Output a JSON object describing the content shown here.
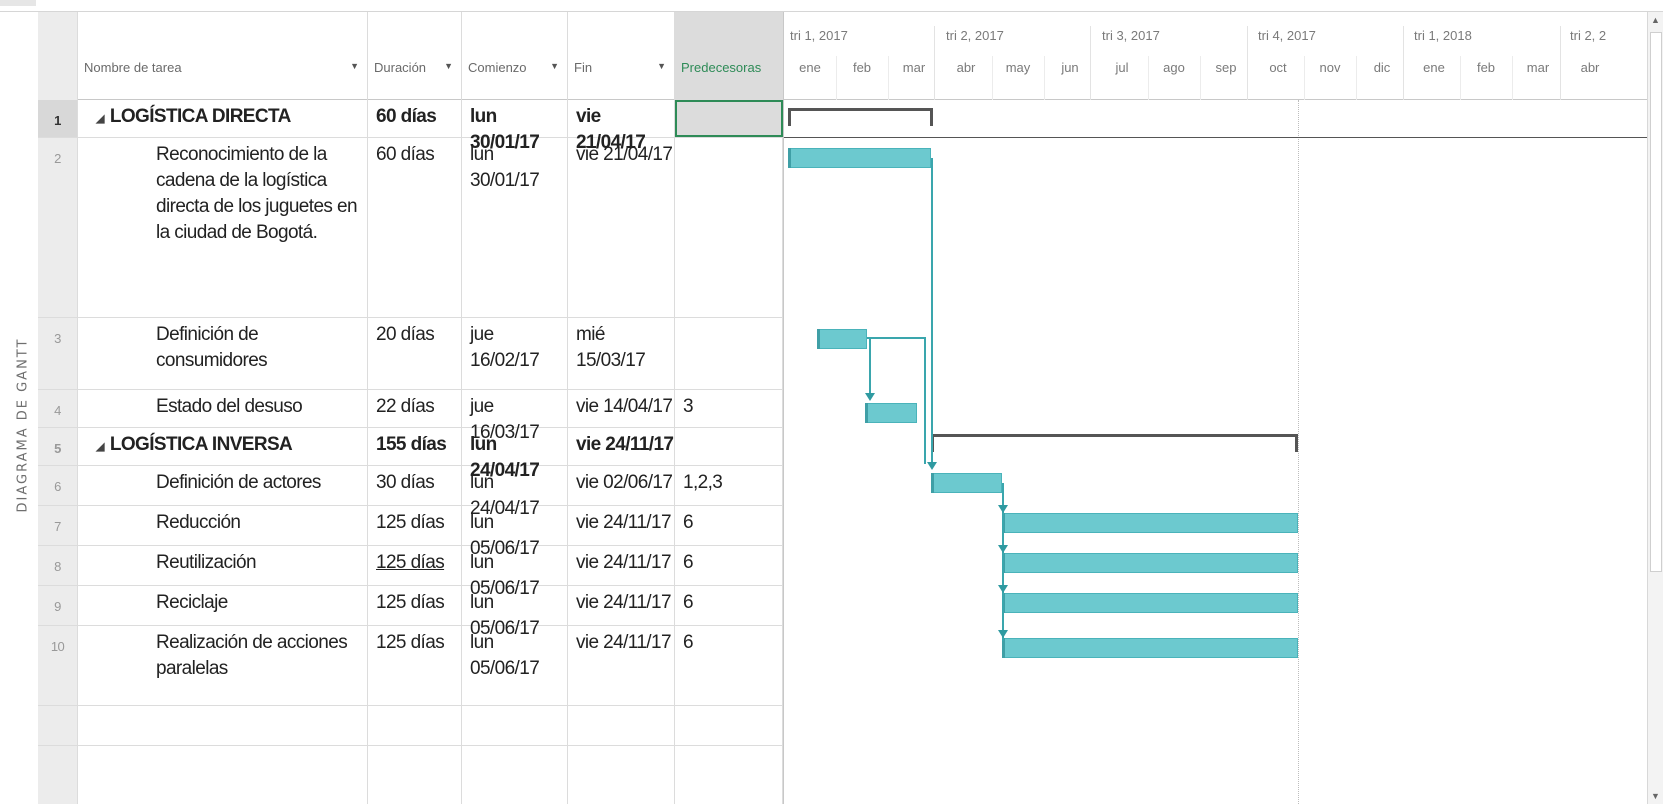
{
  "side_label": "DIAGRAMA DE GANTT",
  "columns": {
    "name": "Nombre de tarea",
    "duration": "Duración",
    "start": "Comienzo",
    "finish": "Fin",
    "predecessors": "Predecesoras"
  },
  "timescale": {
    "quarters": [
      "tri 1, 2017",
      "tri 2, 2017",
      "tri 3, 2017",
      "tri 4, 2017",
      "tri 1, 2018",
      "tri 2, 2"
    ],
    "months": [
      "ene",
      "feb",
      "mar",
      "abr",
      "may",
      "jun",
      "jul",
      "ago",
      "sep",
      "oct",
      "nov",
      "dic",
      "ene",
      "feb",
      "mar",
      "abr"
    ]
  },
  "tasks": [
    {
      "id": "1",
      "name": "LOGÍSTICA DIRECTA",
      "duration": "60 días",
      "start": "lun 30/01/17",
      "finish": "vie 21/04/17",
      "pred": "",
      "summary": true
    },
    {
      "id": "2",
      "name": "Reconocimiento de la cadena de la logística directa de los juguetes en la ciudad de Bogotá.",
      "duration": "60 días",
      "start": "lun 30/01/17",
      "finish": "vie 21/04/17",
      "pred": "",
      "summary": false
    },
    {
      "id": "3",
      "name": "Definición de consumidores",
      "duration": "20 días",
      "start": "jue 16/02/17",
      "finish": "mié 15/03/17",
      "pred": "",
      "summary": false
    },
    {
      "id": "4",
      "name": "Estado del desuso",
      "duration": "22 días",
      "start": "jue 16/03/17",
      "finish": "vie 14/04/17",
      "pred": "3",
      "summary": false
    },
    {
      "id": "5",
      "name": "LOGÍSTICA INVERSA",
      "duration": "155 días",
      "start": "lun 24/04/17",
      "finish": "vie 24/11/17",
      "pred": "",
      "summary": true
    },
    {
      "id": "6",
      "name": "Definición de actores",
      "duration": "30 días",
      "start": "lun 24/04/17",
      "finish": "vie 02/06/17",
      "pred": "1,2,3",
      "summary": false
    },
    {
      "id": "7",
      "name": "Reducción",
      "duration": "125 días",
      "start": "lun 05/06/17",
      "finish": "vie 24/11/17",
      "pred": "6",
      "summary": false
    },
    {
      "id": "8",
      "name": "Reutilización",
      "duration": "125 días",
      "start": "lun 05/06/17",
      "finish": "vie 24/11/17",
      "pred": "6",
      "summary": false
    },
    {
      "id": "9",
      "name": "Reciclaje",
      "duration": "125 días",
      "start": "lun 05/06/17",
      "finish": "vie 24/11/17",
      "pred": "6",
      "summary": false
    },
    {
      "id": "10",
      "name": "Realización de acciones paralelas",
      "duration": "125 días",
      "start": "lun 05/06/17",
      "finish": "vie 24/11/17",
      "pred": "6",
      "summary": false
    }
  ],
  "colors": {
    "task_bar": "#6cc9cf",
    "summary_bar": "#555555",
    "link": "#3aa6ad",
    "predecessors_header": "#2e8b57"
  }
}
